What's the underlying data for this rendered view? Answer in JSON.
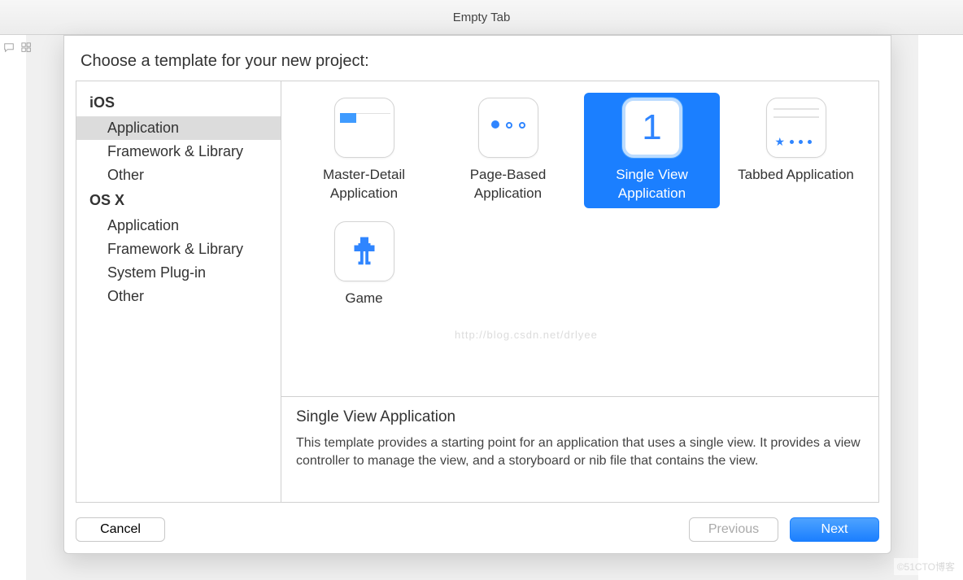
{
  "window": {
    "tab_title": "Empty Tab"
  },
  "sheet": {
    "prompt": "Choose a template for your new project:",
    "sidebar": {
      "groups": [
        {
          "header": "iOS",
          "items": [
            "Application",
            "Framework & Library",
            "Other"
          ],
          "selected_index": 0
        },
        {
          "header": "OS X",
          "items": [
            "Application",
            "Framework & Library",
            "System Plug-in",
            "Other"
          ],
          "selected_index": null
        }
      ]
    },
    "templates": [
      {
        "id": "master-detail",
        "label": "Master-Detail Application",
        "icon": "master-detail-icon"
      },
      {
        "id": "page-based",
        "label": "Page-Based Application",
        "icon": "page-based-icon"
      },
      {
        "id": "single-view",
        "label": "Single View Application",
        "icon": "single-view-icon",
        "selected": true
      },
      {
        "id": "tabbed",
        "label": "Tabbed Application",
        "icon": "tabbed-icon"
      },
      {
        "id": "game",
        "label": "Game",
        "icon": "game-icon"
      }
    ],
    "description": {
      "title": "Single View Application",
      "body": "This template provides a starting point for an application that uses a single view. It provides a view controller to manage the view, and a storyboard or nib file that contains the view."
    },
    "buttons": {
      "cancel": "Cancel",
      "previous": "Previous",
      "next": "Next",
      "previous_enabled": false
    }
  },
  "watermark": "http://blog.csdn.net/drlyee",
  "corner_badge": "©51CTO博客"
}
